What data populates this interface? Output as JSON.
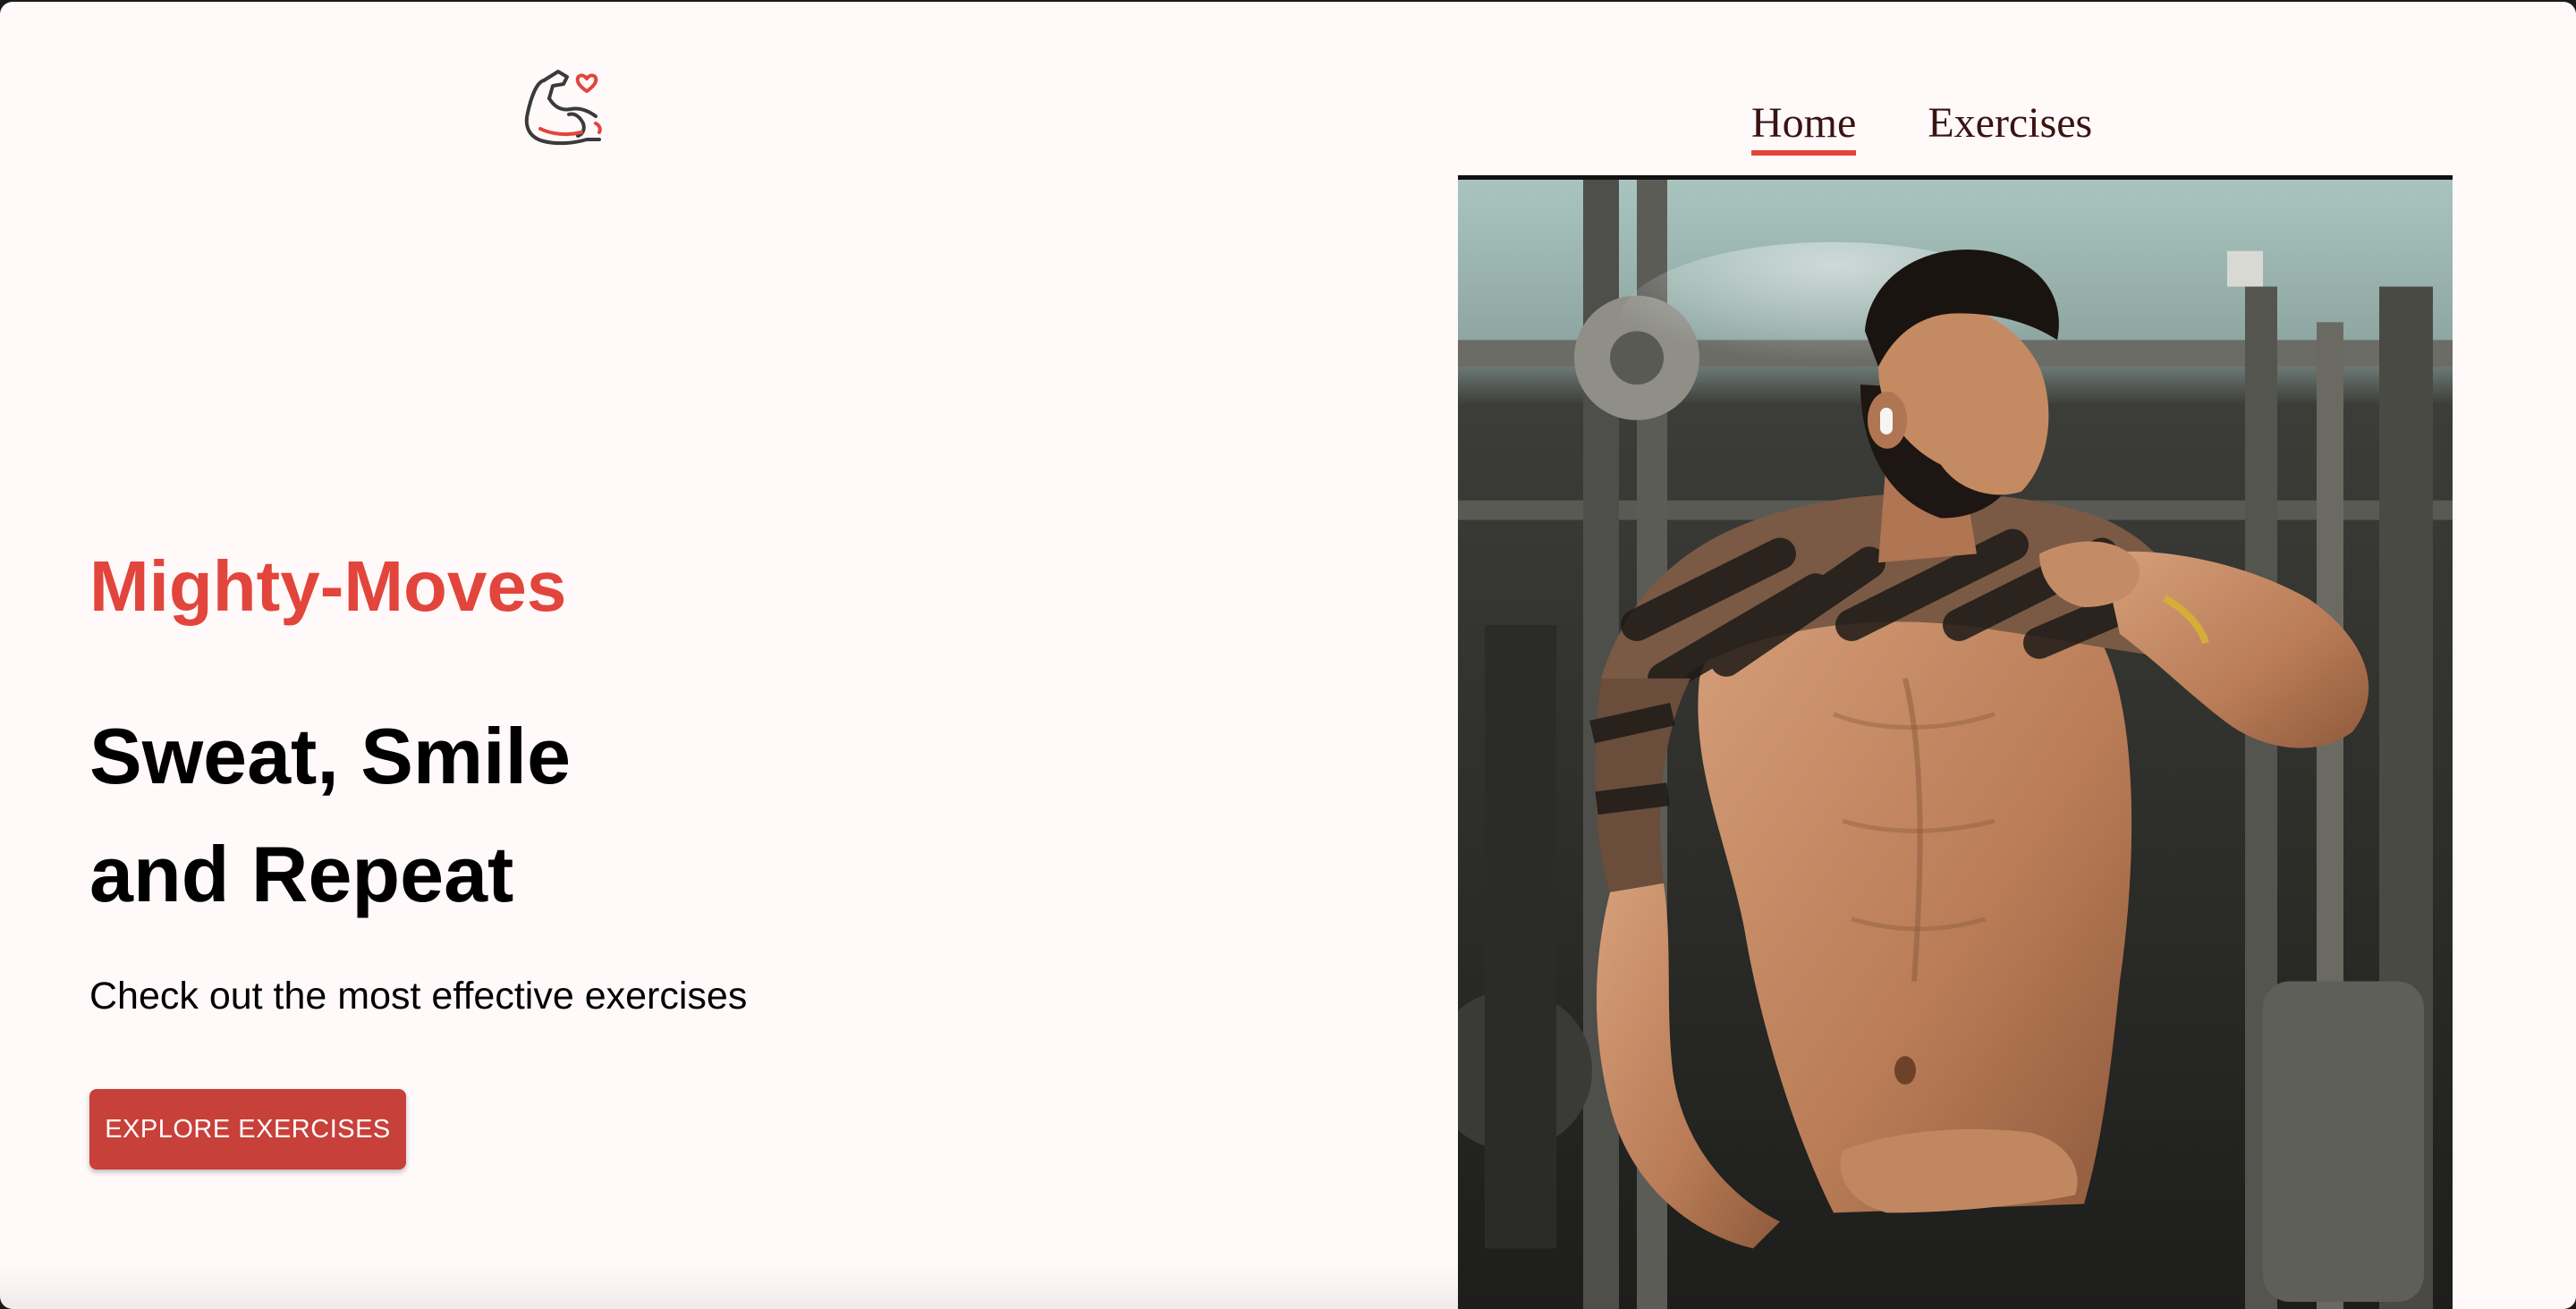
{
  "header": {
    "logo_icon": "flexed-bicep-heart-icon",
    "nav": [
      {
        "label": "Home",
        "active": true
      },
      {
        "label": "Exercises",
        "active": false
      }
    ]
  },
  "hero": {
    "brand": "Mighty-Moves",
    "headline_line1": "Sweat, Smile",
    "headline_line2": "and Repeat",
    "subtext": "Check out the most effective exercises",
    "cta_label": "EXPLORE EXERCISES",
    "image_icon": "gym-athlete-photo"
  },
  "colors": {
    "accent": "#e2453c",
    "button": "#c8403a",
    "background": "#fff9fa"
  }
}
